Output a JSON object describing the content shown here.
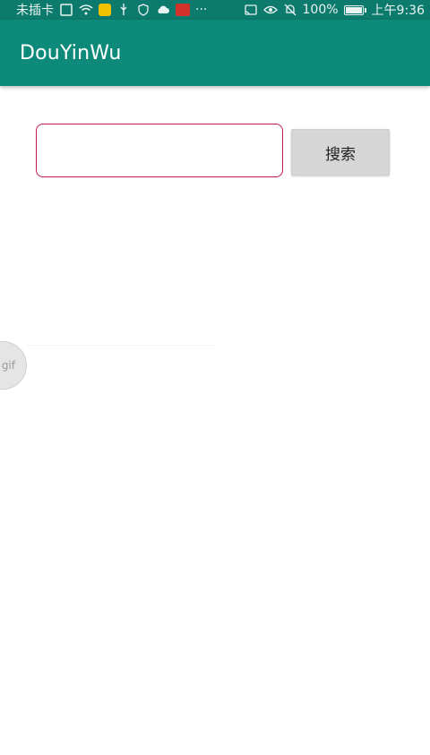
{
  "status_bar": {
    "carrier": "未插卡",
    "signal_box": "1",
    "more": "···",
    "battery_percent": "100%",
    "battery_level": 1.0,
    "time": "上午9:36",
    "icons": [
      "sim-d-icon",
      "wifi-icon",
      "notification-app-icon",
      "usb-icon",
      "shield-icon",
      "cloud-icon",
      "red-app-icon",
      "cast-icon",
      "eye-icon",
      "mute-bell-icon",
      "battery-icon"
    ]
  },
  "app_bar": {
    "title": "DouYinWu"
  },
  "search": {
    "input_value": "",
    "input_placeholder": "",
    "button_label": "搜索"
  },
  "floating": {
    "bubble_label": "gif"
  },
  "colors": {
    "status_bar_bg": "#0c7a6c",
    "app_bar_bg": "#0e8a7a",
    "input_border": "#c2185b",
    "button_bg": "#d6d6d6"
  }
}
